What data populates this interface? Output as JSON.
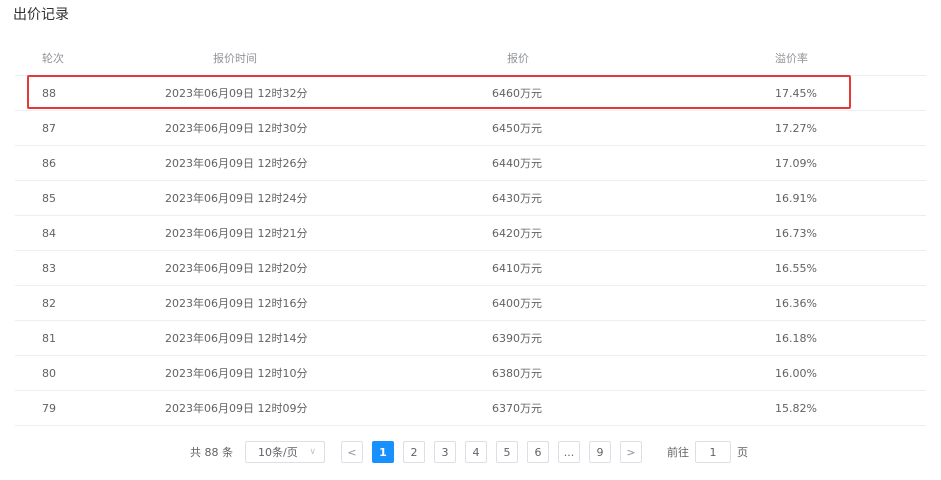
{
  "page": {
    "title": "出价记录"
  },
  "table": {
    "headers": {
      "round": "轮次",
      "time": "报价时间",
      "price": "报价",
      "rate": "溢价率"
    },
    "rows": [
      {
        "round": "88",
        "time": "2023年06月09日 12时32分",
        "price": "6460万元",
        "rate": "17.45%"
      },
      {
        "round": "87",
        "time": "2023年06月09日 12时30分",
        "price": "6450万元",
        "rate": "17.27%"
      },
      {
        "round": "86",
        "time": "2023年06月09日 12时26分",
        "price": "6440万元",
        "rate": "17.09%"
      },
      {
        "round": "85",
        "time": "2023年06月09日 12时24分",
        "price": "6430万元",
        "rate": "16.91%"
      },
      {
        "round": "84",
        "time": "2023年06月09日 12时21分",
        "price": "6420万元",
        "rate": "16.73%"
      },
      {
        "round": "83",
        "time": "2023年06月09日 12时20分",
        "price": "6410万元",
        "rate": "16.55%"
      },
      {
        "round": "82",
        "time": "2023年06月09日 12时16分",
        "price": "6400万元",
        "rate": "16.36%"
      },
      {
        "round": "81",
        "time": "2023年06月09日 12时14分",
        "price": "6390万元",
        "rate": "16.18%"
      },
      {
        "round": "80",
        "time": "2023年06月09日 12时10分",
        "price": "6380万元",
        "rate": "16.00%"
      },
      {
        "round": "79",
        "time": "2023年06月09日 12时09分",
        "price": "6370万元",
        "rate": "15.82%"
      }
    ]
  },
  "pagination": {
    "total_label": "共 88 条",
    "page_size": "10条/页",
    "prev_icon": "chevron-left-icon",
    "next_icon": "chevron-right-icon",
    "pages": [
      "1",
      "2",
      "3",
      "4",
      "5",
      "6",
      "...",
      "9"
    ],
    "current_page": "1",
    "goto_label": "前往",
    "goto_value": "1",
    "goto_suffix": "页",
    "active_color": "#1890ff"
  },
  "highlight_color": "#e53935"
}
